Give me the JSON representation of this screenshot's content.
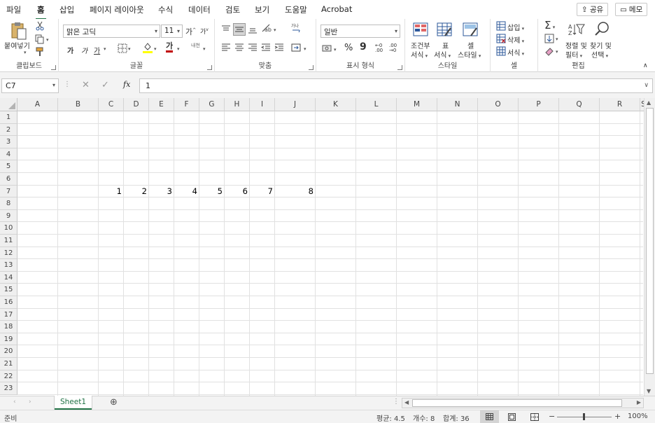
{
  "menu": {
    "tabs": [
      "파일",
      "홈",
      "삽입",
      "페이지 레이아웃",
      "수식",
      "데이터",
      "검토",
      "보기",
      "도움말",
      "Acrobat"
    ],
    "active": "홈",
    "share_label": "공유",
    "memo_label": "메모"
  },
  "ribbon": {
    "clipboard": {
      "paste_label": "붙여넣기",
      "group_label": "클립보드"
    },
    "font": {
      "font_name": "맑은 고딕",
      "font_size": "11",
      "grow": "가",
      "shrink": "가",
      "bold": "가",
      "italic": "가",
      "underline": "가",
      "font_color_letter": "가",
      "phonetic": "내천",
      "group_label": "글꼴",
      "accent_color": "#c00000",
      "highlight_color": "#ffff00"
    },
    "alignment": {
      "group_label": "맞춤"
    },
    "number": {
      "format": "일반",
      "percent": "%",
      "comma": "9",
      "group_label": "표시 형식"
    },
    "styles": {
      "conditional": [
        "조건부",
        "서식"
      ],
      "table": [
        "표",
        "서식"
      ],
      "cell": [
        "셀",
        "스타일"
      ],
      "group_label": "스타일"
    },
    "cells": {
      "insert": "삽입",
      "delete": "삭제",
      "format": "서식",
      "group_label": "셀"
    },
    "editing": {
      "sort": [
        "정렬 및",
        "필터"
      ],
      "find": [
        "찾기 및",
        "선택"
      ],
      "group_label": "편집"
    }
  },
  "formula_bar": {
    "name_box": "C7",
    "fx": "fx",
    "value": "1"
  },
  "grid": {
    "columns": [
      "A",
      "B",
      "C",
      "D",
      "E",
      "F",
      "G",
      "H",
      "I",
      "J",
      "K",
      "L",
      "M",
      "N",
      "O",
      "P",
      "Q",
      "R",
      "S"
    ],
    "rows": [
      "1",
      "2",
      "3",
      "4",
      "5",
      "6",
      "7",
      "8",
      "9",
      "10",
      "11",
      "12",
      "13",
      "14",
      "15",
      "16",
      "17",
      "18",
      "19",
      "20",
      "21",
      "22",
      "23"
    ],
    "row7_values": [
      "1",
      "2",
      "3",
      "4",
      "5",
      "6",
      "7",
      "8"
    ]
  },
  "sheets": {
    "tabs": [
      "Sheet1"
    ],
    "add_label": "⊕"
  },
  "status_bar": {
    "ready": "준비",
    "average": "평균: 4.5",
    "count": "개수: 8",
    "sum": "합계: 36",
    "zoom": "100%"
  },
  "colors": {
    "accent": "#217346"
  }
}
